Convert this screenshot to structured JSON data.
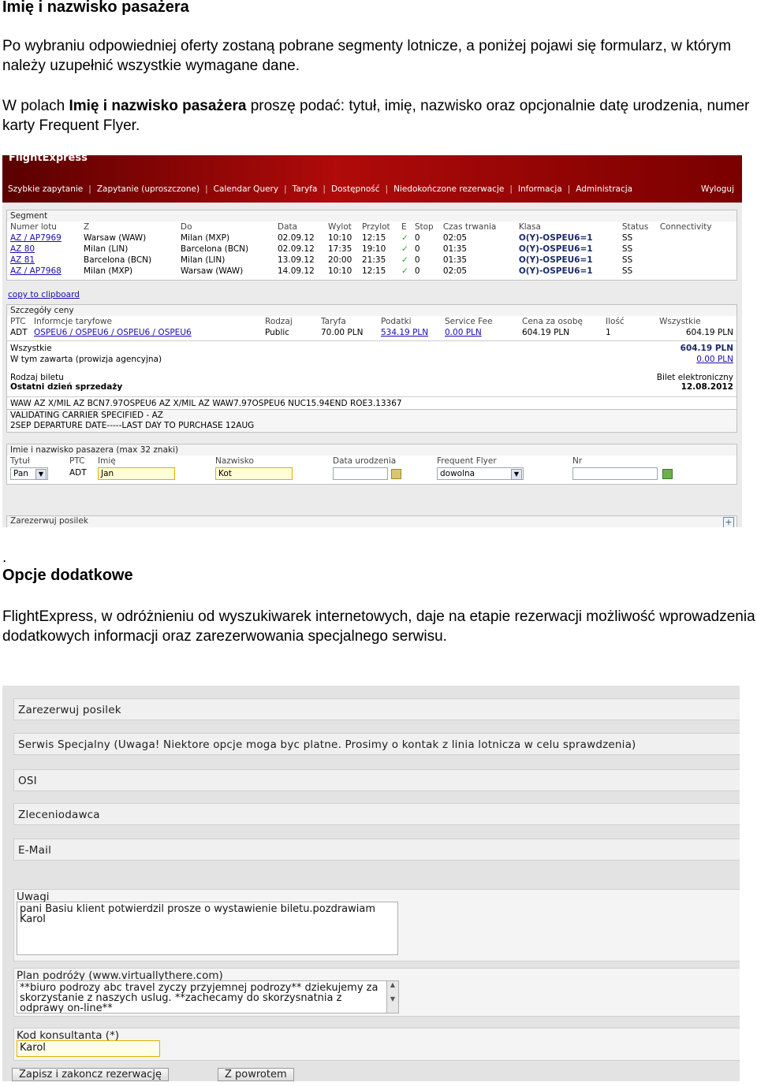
{
  "doc": {
    "h1": "Imię i nazwisko pasażera",
    "p1": "Po wybraniu odpowiedniej oferty zostaną pobrane segmenty lotnicze, a poniżej pojawi się formularz, w którym należy uzupełnić wszystkie wymagane dane.",
    "p2_pre": "W polach ",
    "p2_bold": "Imię i nazwisko pasażera",
    "p2_post": " proszę podać: tytuł, imię, nazwisko oraz opcjonalnie datę urodzenia, numer karty Frequent Flyer.",
    "dot": ".",
    "h2": "Opcje dodatkowe",
    "p3": "FlightExpress, w odróżnieniu od wyszukiwarek internetowych, daje na etapie rezerwacji możliwość wprowadzenia dodatkowych informacji oraz zarezerwowania specjalnego serwisu."
  },
  "app": {
    "logo": "FlightExpress",
    "nav": [
      "Szybkie zapytanie",
      "Zapytanie (uproszczone)",
      "Calendar Query",
      "Taryfa",
      "Dostępność",
      "Niedokończone rezerwacje",
      "Informacja",
      "Administracja"
    ],
    "logout": "Wyloguj",
    "segment": {
      "title": "Segment",
      "headers": [
        "Numer lotu",
        "Z",
        "Do",
        "Data",
        "Wylot",
        "Przylot",
        "E",
        "Stop",
        "Czas trwania",
        "Klasa",
        "Status",
        "Connectivity"
      ],
      "rows": [
        [
          "AZ / AP7969",
          "Warsaw (WAW)",
          "Milan (MXP)",
          "02.09.12",
          "10:10",
          "12:15",
          "0",
          "02:05",
          "O(Y)-OSPEU6=1",
          "SS"
        ],
        [
          "AZ 80",
          "Milan (LIN)",
          "Barcelona (BCN)",
          "02.09.12",
          "17:35",
          "19:10",
          "0",
          "01:35",
          "O(Y)-OSPEU6=1",
          "SS"
        ],
        [
          "AZ 81",
          "Barcelona (BCN)",
          "Milan (LIN)",
          "13.09.12",
          "20:00",
          "21:35",
          "0",
          "01:35",
          "O(Y)-OSPEU6=1",
          "SS"
        ],
        [
          "AZ / AP7968",
          "Milan (MXP)",
          "Warsaw (WAW)",
          "14.09.12",
          "10:10",
          "12:15",
          "0",
          "02:05",
          "O(Y)-OSPEU6=1",
          "SS"
        ]
      ]
    },
    "clipboard": "copy to clipboard",
    "price": {
      "title": "Szczegóły ceny",
      "headers": [
        "PTC",
        "Informcje taryfowe",
        "Rodzaj",
        "Taryfa",
        "Podatki",
        "Service Fee",
        "Cena za osobę",
        "Ilość",
        "Wszystkie"
      ],
      "row": [
        "ADT",
        "OSPEU6 / OSPEU6 / OSPEU6 / OSPEU6",
        "Public",
        "70.00 PLN",
        "534.19 PLN",
        "0.00 PLN",
        "604.19 PLN",
        "1",
        "604.19 PLN"
      ],
      "all_label": "Wszystkie",
      "all_value": "604.19 PLN",
      "agency_label": "W tym zawarta (prowizja agencyjna)",
      "agency_value": "0.00 PLN",
      "ticket_label": "Rodzaj biletu",
      "ticket_value": "Bilet elektroniczny",
      "lastday_label": "Ostatni dzień sprzedaży",
      "lastday_value": "12.08.2012",
      "fare_calc": "WAW AZ X/MIL AZ BCN7.97OSPEU6 AZ X/MIL AZ WAW7.97OSPEU6 NUC15.94END ROE3.13367",
      "remarks": [
        "VALIDATING CARRIER SPECIFIED - AZ",
        "2SEP DEPARTURE DATE-----LAST DAY TO PURCHASE 12AUG"
      ]
    },
    "pax": {
      "title": "Imie i nazwisko pasazera (max 32 znaki)",
      "headers": [
        "Tytuł",
        "PTC",
        "Imię",
        "Nazwisko",
        "Data urodzenia",
        "Frequent Flyer",
        "Nr"
      ],
      "title_value": "Pan",
      "ptc": "ADT",
      "first": "Jan",
      "last": "Kot",
      "ff_value": "dowolna"
    },
    "meal_small": "Zarezerwuj posilek"
  },
  "options": {
    "meal": "Zarezerwuj posilek",
    "ssr": "Serwis Specjalny (Uwaga! Niektore opcje moga byc platne. Prosimy o kontak z linia lotnicza w celu sprawdzenia)",
    "osi": "OSI",
    "orderer": "Zleceniodawca",
    "email": "E-Mail",
    "remarks_label": "Uwagi",
    "remarks_value": "pani Basiu klient potwierdzil prosze o wystawienie biletu.pozdrawiam Karol",
    "trip_label": "Plan podróży (www.virtuallythere.com)",
    "trip_value": "**biuro podrozy abc travel zyczy przyjemnej podrozy** dziekujemy za skorzystanie z naszych uslug. **zachecamy do skorzysnatnia z odprawy on-line**",
    "consultant_label": "Kod konsultanta (*)",
    "consultant_value": "Karol",
    "save_btn": "Zapisz i zakoncz rezerwację",
    "back_btn": "Z powrotem"
  },
  "colors": {
    "banner": "#a00000",
    "link": "#1a0dab",
    "check": "#2e9e2e"
  }
}
